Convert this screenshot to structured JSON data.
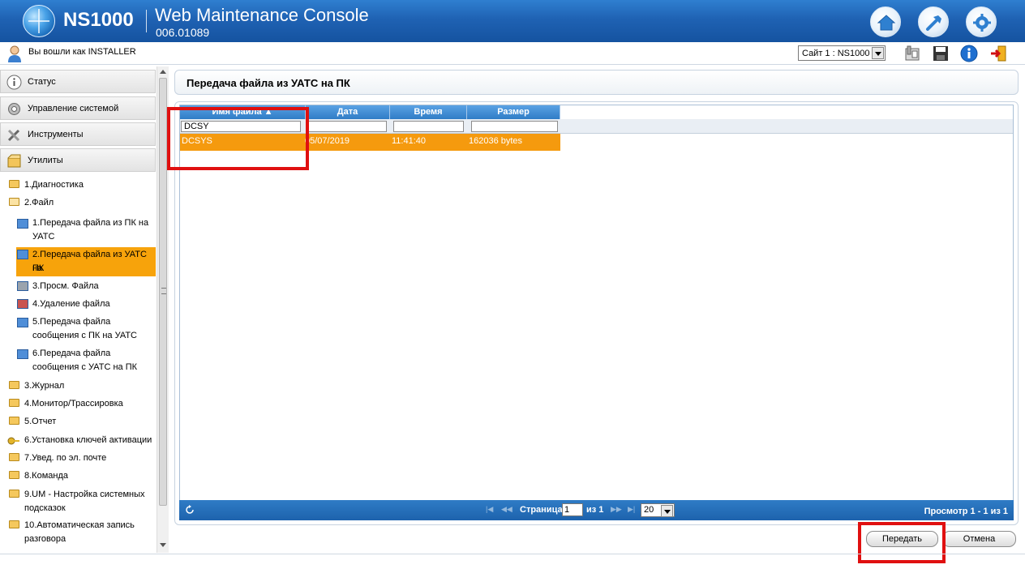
{
  "header": {
    "brand": "NS1000",
    "title": "Web Maintenance Console",
    "version": "006.01089",
    "colors": {
      "header_blue": "#1f62b3",
      "accent_orange": "#f59a0e"
    },
    "icons": [
      "home-icon",
      "tools-icon",
      "settings-icon"
    ]
  },
  "subheader": {
    "login_text": "Вы вошли как INSTALLER",
    "site_selector": "Сайт 1 : NS1000",
    "icons": [
      "phone-icon",
      "save-icon",
      "info-icon",
      "logout-icon"
    ]
  },
  "sidebar": {
    "sections": [
      {
        "label": "Статус",
        "icon": "info-icon"
      },
      {
        "label": "Управление системой",
        "icon": "gear-icon"
      },
      {
        "label": "Инструменты",
        "icon": "tools-icon"
      },
      {
        "label": "Утилиты",
        "icon": "box-icon"
      }
    ],
    "items": [
      {
        "label": "1.Диагностика"
      },
      {
        "label": "2.Файл"
      },
      {
        "label": "1.Передача файла из ПК на",
        "label2": "УАТС"
      },
      {
        "label": "2.Передача файла из УАТС на",
        "label2": "ПК"
      },
      {
        "label": "3.Просм. Файла"
      },
      {
        "label": "4.Удаление файла"
      },
      {
        "label": "5.Передача файла",
        "label2": "сообщения с ПК на УАТС"
      },
      {
        "label": "6.Передача файла",
        "label2": "сообщения с УАТС на ПК"
      },
      {
        "label": "3.Журнал"
      },
      {
        "label": "4.Монитор/Трассировка"
      },
      {
        "label": "5.Отчет"
      },
      {
        "label": "6.Установка ключей активации"
      },
      {
        "label": "7.Увед. по эл. почте"
      },
      {
        "label": "8.Команда"
      },
      {
        "label": "9.UM - Настройка системных",
        "label2": "подсказок"
      },
      {
        "label": "10.Автоматическая запись",
        "label2": "разговора"
      }
    ]
  },
  "main": {
    "title": "Передача файла из УАТС на ПК",
    "columns": [
      "Имя файла",
      "Дата",
      "Время",
      "Размер"
    ],
    "filters": [
      "DCSY",
      "",
      "",
      ""
    ],
    "rows": [
      {
        "name": "DCSYS",
        "date": "05/07/2019",
        "time": "11:41:40",
        "size": "162036 bytes"
      }
    ],
    "pager": {
      "page_label": "Страница",
      "page": "1",
      "of_label": "из 1",
      "page_size": "20",
      "info": "Просмотр 1 - 1 из 1"
    },
    "buttons": {
      "transfer": "Передать",
      "cancel": "Отмена"
    }
  }
}
